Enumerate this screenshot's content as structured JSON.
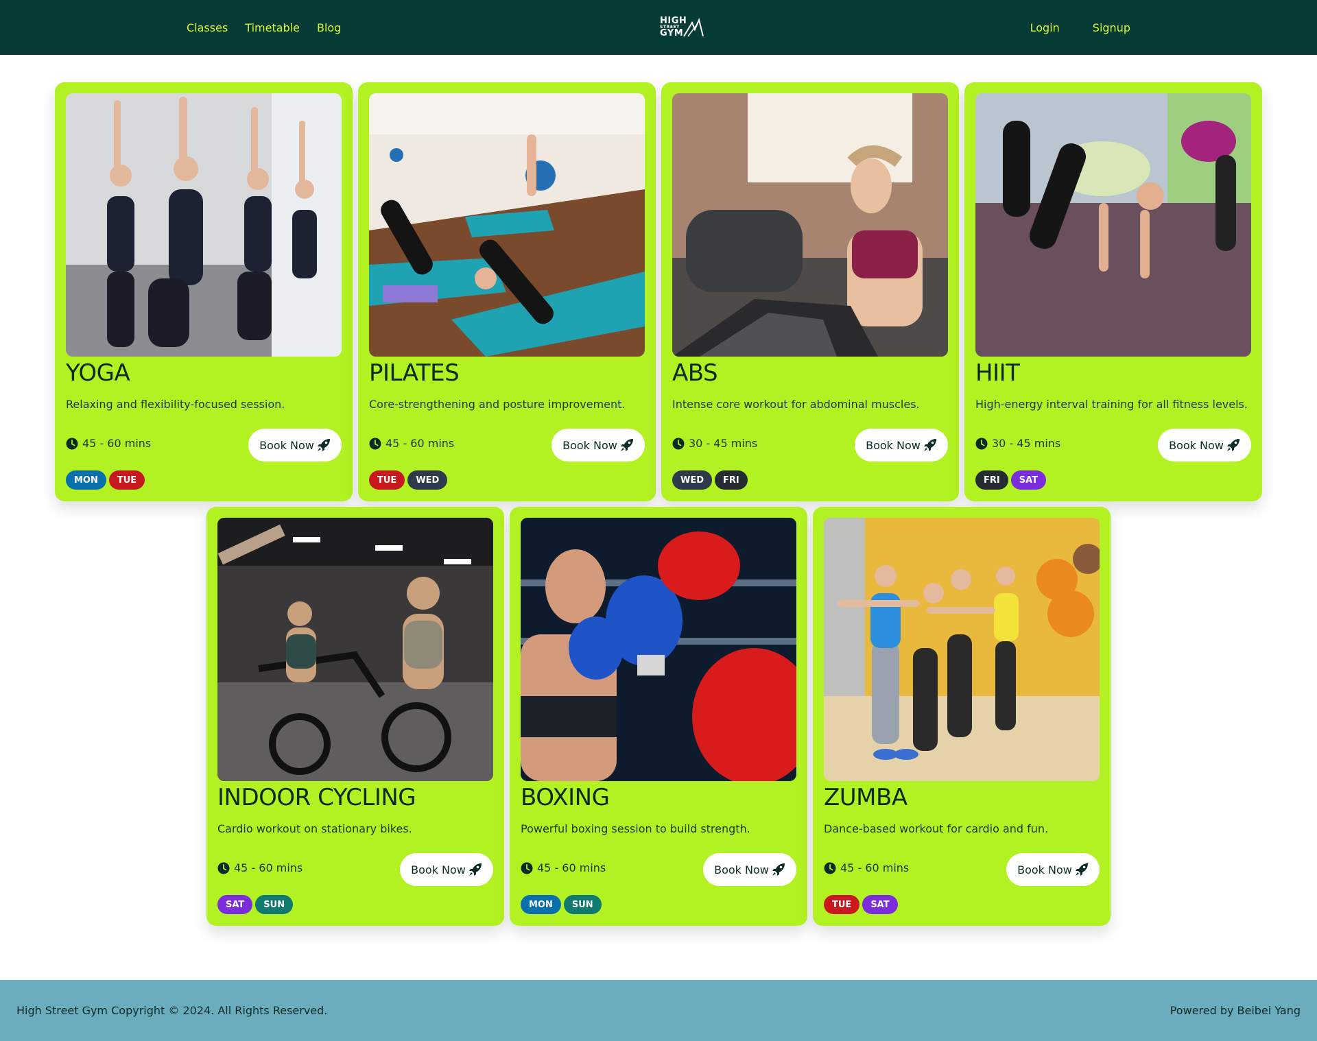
{
  "nav": {
    "left": [
      "Classes",
      "Timetable",
      "Blog"
    ],
    "right": [
      "Login",
      "Signup"
    ]
  },
  "logo": {
    "line1": "HIGH",
    "line2": "STREET",
    "line3": "GYM"
  },
  "classes": [
    {
      "title": "YOGA",
      "description": "Relaxing and flexibility-focused session.",
      "duration": "45 - 60 mins",
      "button": "Book Now",
      "days": [
        "MON",
        "TUE"
      ]
    },
    {
      "title": "PILATES",
      "description": "Core-strengthening and posture improvement.",
      "duration": "45 - 60 mins",
      "button": "Book Now",
      "days": [
        "TUE",
        "WED"
      ]
    },
    {
      "title": "ABS",
      "description": "Intense core workout for abdominal muscles.",
      "duration": "30 - 45 mins",
      "button": "Book Now",
      "days": [
        "WED",
        "FRI"
      ]
    },
    {
      "title": "HIIT",
      "description": "High-energy interval training for all fitness levels.",
      "duration": "30 - 45 mins",
      "button": "Book Now",
      "days": [
        "FRI",
        "SAT"
      ]
    },
    {
      "title": "INDOOR CYCLING",
      "description": "Cardio workout on stationary bikes.",
      "duration": "45 - 60 mins",
      "button": "Book Now",
      "days": [
        "SAT",
        "SUN"
      ]
    },
    {
      "title": "BOXING",
      "description": "Powerful boxing session to build strength.",
      "duration": "45 - 60 mins",
      "button": "Book Now",
      "days": [
        "MON",
        "SUN"
      ]
    },
    {
      "title": "ZUMBA",
      "description": "Dance-based workout for cardio and fun.",
      "duration": "45 - 60 mins",
      "button": "Book Now",
      "days": [
        "TUE",
        "SAT"
      ]
    }
  ],
  "day_colors": {
    "MON": "#0a6fad",
    "TUE": "#c8191e",
    "WED": "#2f3b4a",
    "FRI": "#252d31",
    "SAT": "#7b2cdc",
    "SUN": "#0f7a6d"
  },
  "footer": {
    "copyright": "High Street Gym Copyright © 2024. All Rights Reserved.",
    "credit": "Powered by Beibei Yang"
  },
  "colors": {
    "header_bg": "#073b36",
    "nav_link": "#d9f43a",
    "card_bg": "#b3f222",
    "footer_bg": "#6badbf"
  }
}
